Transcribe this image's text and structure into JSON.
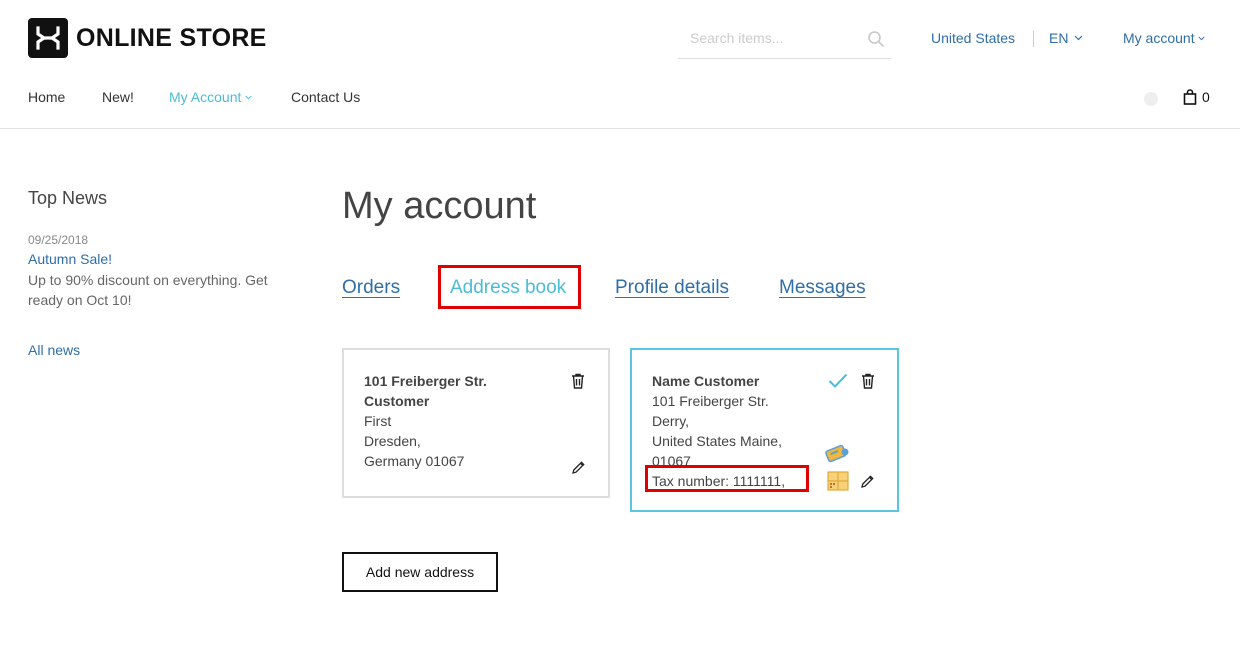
{
  "header": {
    "brand": "ONLINE STORE",
    "search_placeholder": "Search items...",
    "country": "United States",
    "language": "EN",
    "account_label": "My account",
    "cart_count": "0"
  },
  "nav": {
    "items": [
      "Home",
      "New!",
      "My Account",
      "Contact Us"
    ],
    "active": "My Account"
  },
  "sidebar": {
    "heading": "Top News",
    "news": [
      {
        "date": "09/25/2018",
        "title": "Autumn Sale!",
        "body": "Up to 90% discount on everything. Get ready on Oct 10!"
      }
    ],
    "all_news": "All news"
  },
  "main": {
    "title": "My account",
    "tabs": [
      "Orders",
      "Address book",
      "Profile details",
      "Messages"
    ],
    "active_tab": "Address book",
    "addresses": [
      {
        "lines": [
          "101 Freiberger Str.",
          "Customer",
          "First",
          "Dresden,",
          "Germany 01067"
        ],
        "bold_lines": 2,
        "selected": false
      },
      {
        "lines": [
          "Name Customer",
          "101 Freiberger Str.",
          "Derry,",
          "United States Maine,",
          "01067",
          "Tax number: 1111111,"
        ],
        "bold_lines": 1,
        "selected": true
      }
    ],
    "add_button": "Add new address"
  },
  "colors": {
    "link": "#2f6ea8",
    "accent": "#4bbcd8",
    "highlight": "#e00000"
  }
}
